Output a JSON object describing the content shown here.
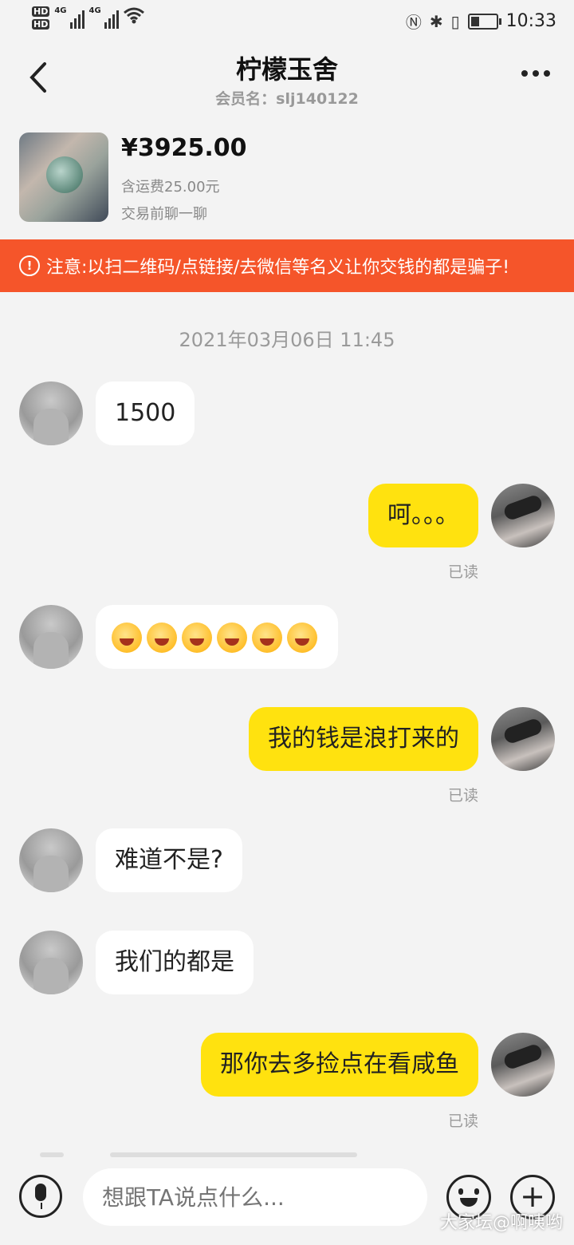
{
  "status_bar": {
    "time": "10:33",
    "hd1": "HD",
    "hd2": "HD",
    "net1": "4G",
    "net2": "4G"
  },
  "header": {
    "title": "柠檬玉舍",
    "subtitle": "会员名：slj140122"
  },
  "product": {
    "price": "¥3925.00",
    "shipping": "含运费25.00元",
    "chat_prompt": "交易前聊一聊"
  },
  "warning": {
    "icon": "!",
    "text": "注意:以扫二维码/点链接/去微信等名义让你交钱的都是骗子!"
  },
  "chat": {
    "timestamp": "2021年03月06日 11:45",
    "messages": [
      {
        "from": "them",
        "text": "1500"
      },
      {
        "from": "me",
        "text": "呵。。。",
        "status": "已读"
      },
      {
        "from": "them",
        "emoji": [
          "grin",
          "grin",
          "grin",
          "giggle",
          "giggle",
          "giggle"
        ]
      },
      {
        "from": "me",
        "text": "我的钱是浪打来的",
        "status": "已读"
      },
      {
        "from": "them",
        "text": "难道不是?"
      },
      {
        "from": "them",
        "text": "我们的都是"
      },
      {
        "from": "me",
        "text": "那你去多捡点在看咸鱼",
        "status": "已读"
      }
    ]
  },
  "input_bar": {
    "placeholder": "想跟TA说点什么...",
    "plus": "+"
  },
  "watermark": "大家坛@啊咦哟"
}
